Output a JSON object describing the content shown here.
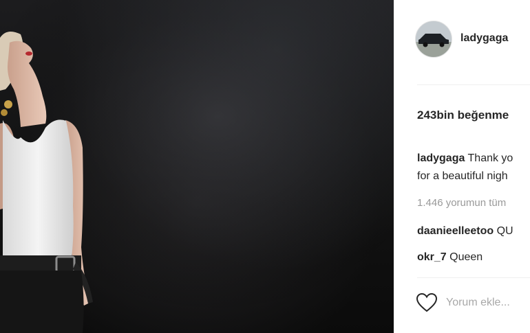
{
  "post": {
    "author": "ladygaga"
  },
  "likes_text": "243bin beğenme",
  "caption": {
    "username": "ladygaga",
    "line1": "Thank yo",
    "line2": "for a beautiful nigh"
  },
  "view_all_comments": "1.446 yorumun tüm",
  "comments": [
    {
      "username": "daanieelleetoo",
      "text": "QU"
    },
    {
      "username": "okr_7",
      "text": "Queen"
    }
  ],
  "add_comment": {
    "placeholder": "Yorum ekle..."
  },
  "icons": {
    "like": "heart-outline-icon",
    "avatar": "profile-avatar"
  },
  "colors": {
    "text": "#262626",
    "muted": "#999999",
    "placeholder": "#a8a8a8",
    "divider": "#efefef"
  }
}
